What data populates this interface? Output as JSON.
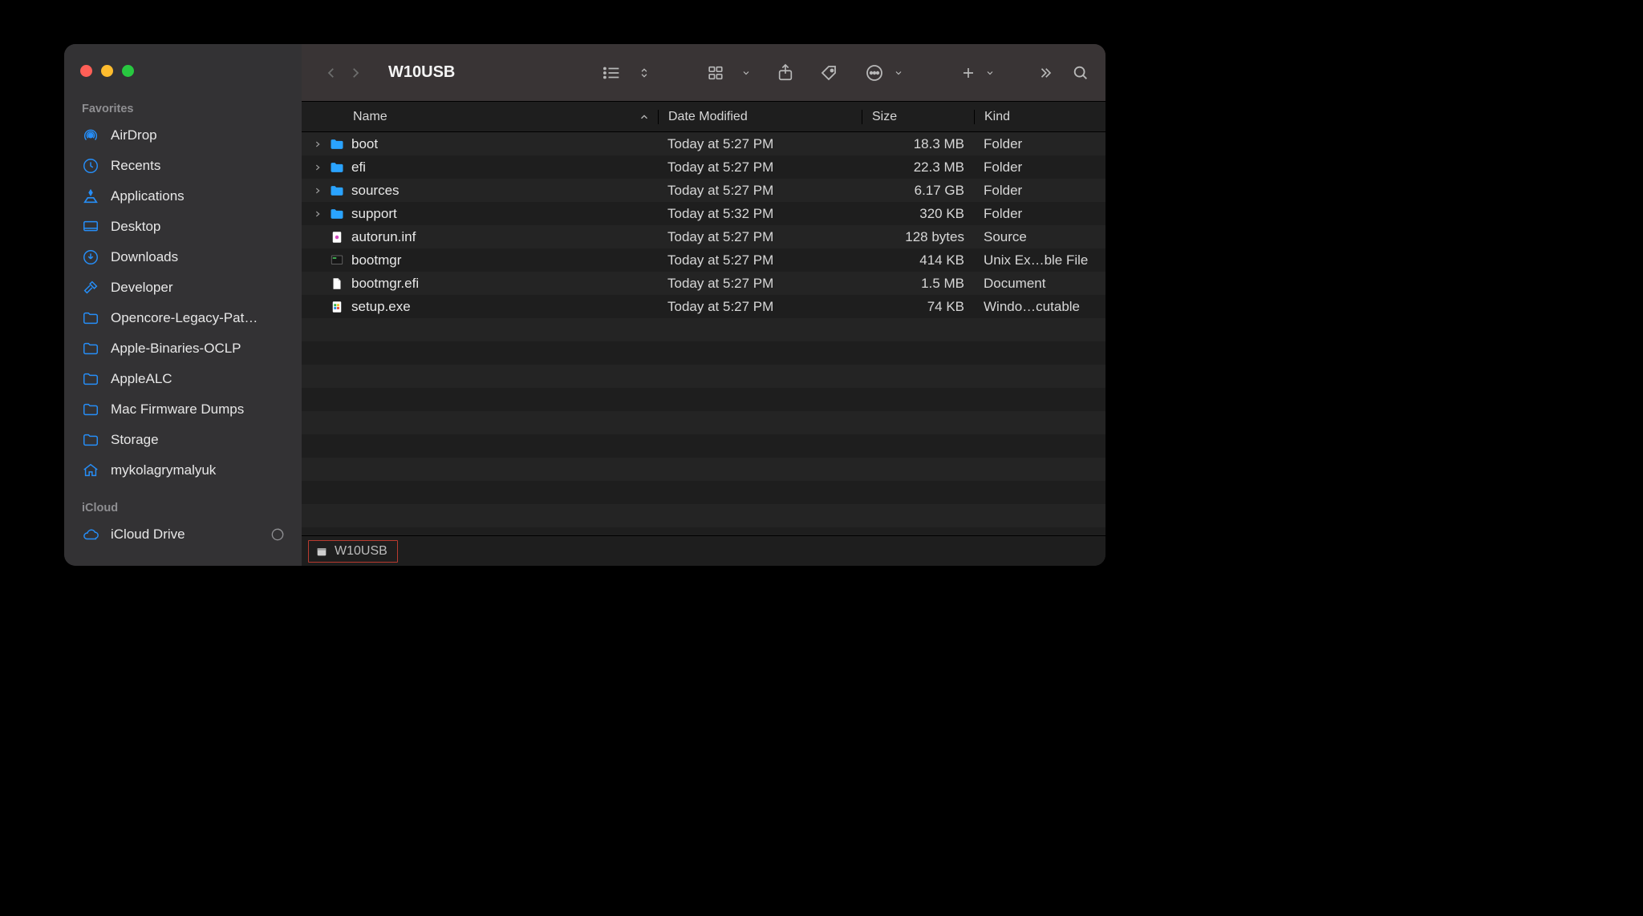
{
  "window_title": "W10USB",
  "sidebar": {
    "sections": [
      {
        "label": "Favorites",
        "items": [
          {
            "icon": "airdrop",
            "label": "AirDrop"
          },
          {
            "icon": "clock",
            "label": "Recents"
          },
          {
            "icon": "apps",
            "label": "Applications"
          },
          {
            "icon": "desktop",
            "label": "Desktop"
          },
          {
            "icon": "download",
            "label": "Downloads"
          },
          {
            "icon": "hammer",
            "label": "Developer"
          },
          {
            "icon": "folder",
            "label": "Opencore-Legacy-Pat…"
          },
          {
            "icon": "folder",
            "label": "Apple-Binaries-OCLP"
          },
          {
            "icon": "folder",
            "label": "AppleALC"
          },
          {
            "icon": "folder",
            "label": "Mac Firmware Dumps"
          },
          {
            "icon": "folder",
            "label": "Storage"
          },
          {
            "icon": "home",
            "label": "mykolagrymalyuk"
          }
        ]
      },
      {
        "label": "iCloud",
        "items": [
          {
            "icon": "cloud",
            "label": "iCloud Drive",
            "trailing": "progress"
          }
        ]
      }
    ]
  },
  "columns": {
    "name": "Name",
    "date": "Date Modified",
    "size": "Size",
    "kind": "Kind"
  },
  "files": [
    {
      "expandable": true,
      "icon": "folder",
      "name": "boot",
      "date": "Today at 5:27 PM",
      "size": "18.3 MB",
      "kind": "Folder"
    },
    {
      "expandable": true,
      "icon": "folder",
      "name": "efi",
      "date": "Today at 5:27 PM",
      "size": "22.3 MB",
      "kind": "Folder"
    },
    {
      "expandable": true,
      "icon": "folder",
      "name": "sources",
      "date": "Today at 5:27 PM",
      "size": "6.17 GB",
      "kind": "Folder"
    },
    {
      "expandable": true,
      "icon": "folder",
      "name": "support",
      "date": "Today at 5:32 PM",
      "size": "320 KB",
      "kind": "Folder"
    },
    {
      "expandable": false,
      "icon": "src",
      "name": "autorun.inf",
      "date": "Today at 5:27 PM",
      "size": "128 bytes",
      "kind": "Source"
    },
    {
      "expandable": false,
      "icon": "exec",
      "name": "bootmgr",
      "date": "Today at 5:27 PM",
      "size": "414 KB",
      "kind": "Unix Ex…ble File"
    },
    {
      "expandable": false,
      "icon": "doc",
      "name": "bootmgr.efi",
      "date": "Today at 5:27 PM",
      "size": "1.5 MB",
      "kind": "Document"
    },
    {
      "expandable": false,
      "icon": "winexe",
      "name": "setup.exe",
      "date": "Today at 5:27 PM",
      "size": "74 KB",
      "kind": "Windo…cutable"
    }
  ],
  "pathbar": {
    "label": "W10USB"
  }
}
